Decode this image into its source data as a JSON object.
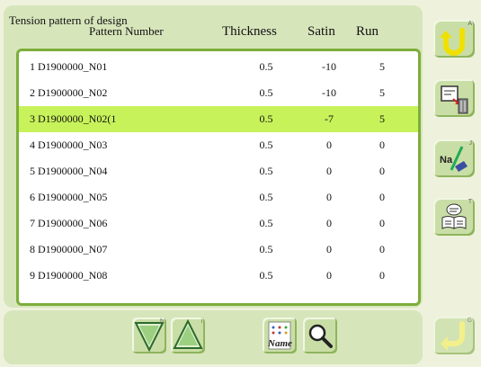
{
  "header": {
    "title": "Tension pattern of design",
    "pattern_number_label": "Pattern Number",
    "col_thickness": "Thickness",
    "col_satin": "Satin",
    "col_run": "Run"
  },
  "rows": [
    {
      "index": "1",
      "name": "D1900000_N01",
      "thickness": "0.5",
      "satin": "-10",
      "run": "5"
    },
    {
      "index": "2",
      "name": "D1900000_N02",
      "thickness": "0.5",
      "satin": "-10",
      "run": "5"
    },
    {
      "index": "3",
      "name": "D1900000_N02(1",
      "thickness": "0.5",
      "satin": "-7",
      "run": "5"
    },
    {
      "index": "4",
      "name": "D1900000_N03",
      "thickness": "0.5",
      "satin": "0",
      "run": "0"
    },
    {
      "index": "5",
      "name": "D1900000_N04",
      "thickness": "0.5",
      "satin": "0",
      "run": "0"
    },
    {
      "index": "6",
      "name": "D1900000_N05",
      "thickness": "0.5",
      "satin": "0",
      "run": "0"
    },
    {
      "index": "7",
      "name": "D1900000_N06",
      "thickness": "0.5",
      "satin": "0",
      "run": "0"
    },
    {
      "index": "8",
      "name": "D1900000_N07",
      "thickness": "0.5",
      "satin": "0",
      "run": "0"
    },
    {
      "index": "9",
      "name": "D1900000_N08",
      "thickness": "0.5",
      "satin": "0",
      "run": "0"
    }
  ],
  "selected_row": 3,
  "side_buttons": {
    "undo_key": "A",
    "delete_key": "",
    "rename_key": "J",
    "rename_text": "Na",
    "catalog_key": "T"
  },
  "bottom_buttons": {
    "down_key": "h",
    "up_key": "i",
    "name_text": "Name",
    "enter_key": "G"
  },
  "colors": {
    "panel": "#d7e5bb",
    "list_border": "#7cae3a",
    "selected_row": "#c8f25a",
    "icon_yellow": "#f0e000"
  }
}
